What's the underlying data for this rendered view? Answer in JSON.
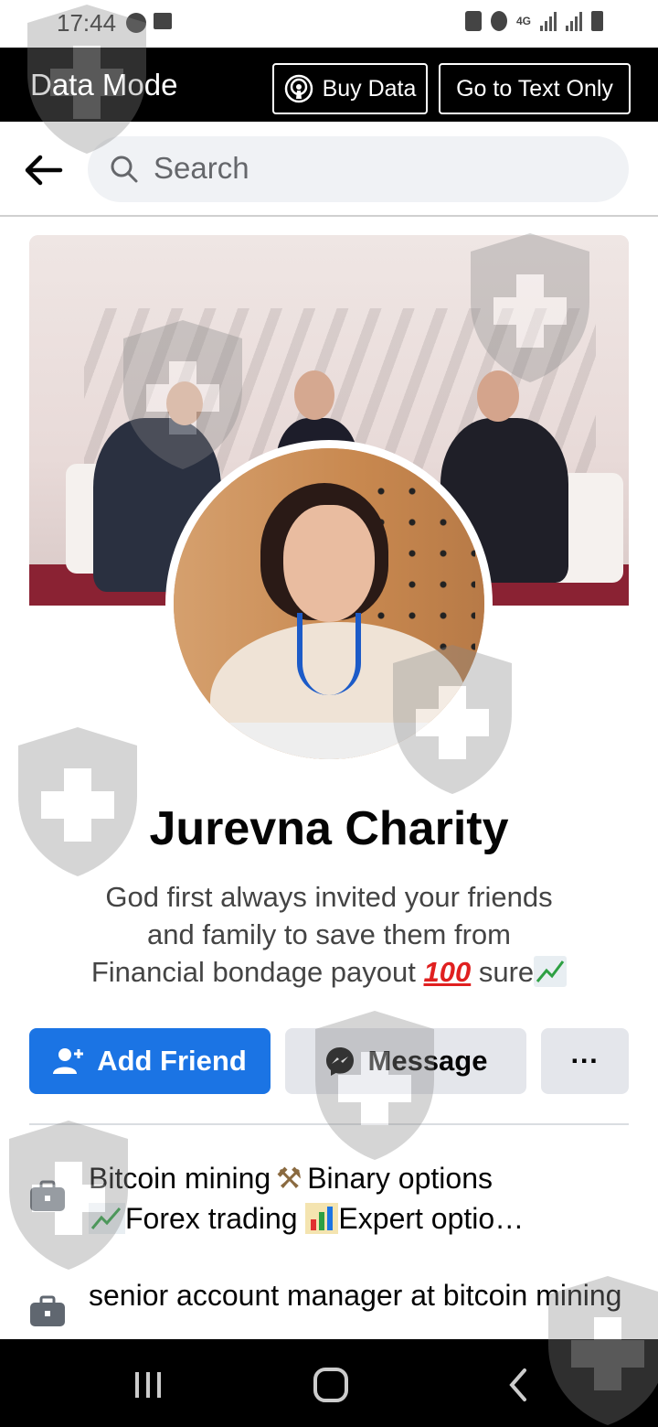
{
  "status_bar": {
    "time": "17:44",
    "network": "4G"
  },
  "data_mode_bar": {
    "title": "Data Mode",
    "buy_data_label": "Buy Data",
    "text_only_label": "Go to Text Only"
  },
  "search": {
    "placeholder": "Search"
  },
  "profile": {
    "name": "Jurevna Charity",
    "bio_line1": "God first always invited your friends",
    "bio_line2": "and family to save them from",
    "bio_line3_text": "Financial bondage payout",
    "bio_emoji_100": "100",
    "bio_line3_end": "sure"
  },
  "actions": {
    "add_friend_label": "Add Friend",
    "message_label": "Message",
    "more_label": "···"
  },
  "details": [
    {
      "icon": "briefcase-icon",
      "line1_a": "Bitcoin mining",
      "line1_b": "Binary options",
      "line2_a": "Forex trading",
      "line2_b": "Expert optio…"
    },
    {
      "icon": "briefcase-icon",
      "text": "senior account manager at bitcoin mining"
    }
  ],
  "colors": {
    "primary": "#1b74e4",
    "secondary_button": "#e4e6eb",
    "header_bg": "#000000"
  }
}
